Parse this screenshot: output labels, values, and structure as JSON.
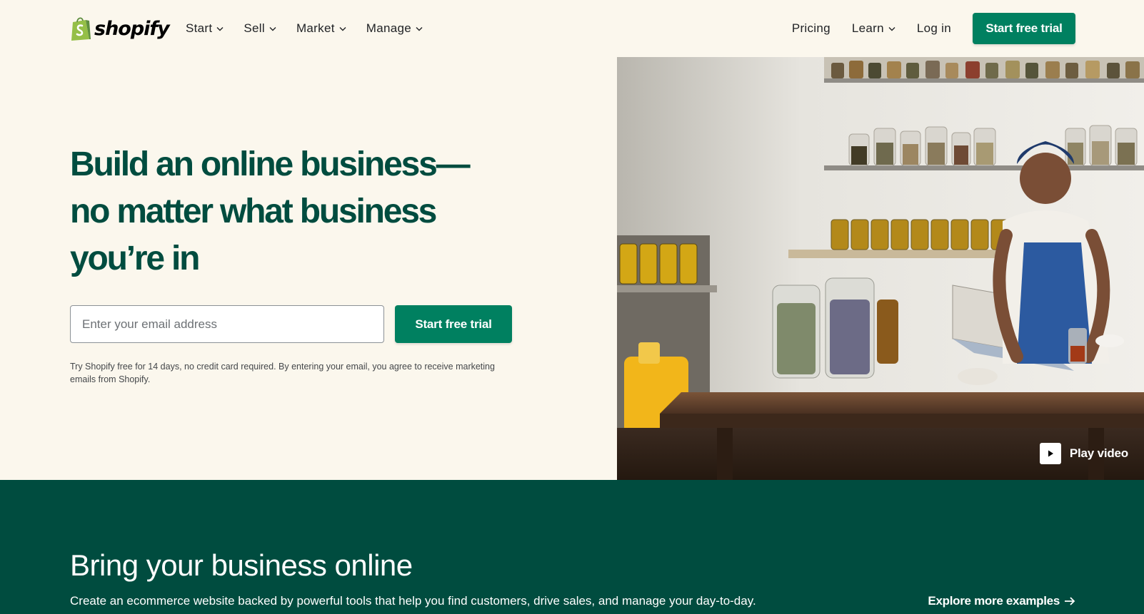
{
  "nav": {
    "logo_text": "shopify",
    "left_items": [
      {
        "label": "Start"
      },
      {
        "label": "Sell"
      },
      {
        "label": "Market"
      },
      {
        "label": "Manage"
      }
    ],
    "pricing": "Pricing",
    "learn": "Learn",
    "login": "Log in",
    "cta": "Start free trial"
  },
  "hero": {
    "title_line1": "Build an online business—",
    "title_line2": "no matter what business",
    "title_line3": "you’re in",
    "email_placeholder": "Enter your email address",
    "cta": "Start free trial",
    "disclaimer": "Try Shopify free for 14 days, no credit card required. By entering your email, you agree to receive marketing emails from Shopify.",
    "play_video": "Play video"
  },
  "section": {
    "title": "Bring your business online",
    "subtitle": "Create an ecommerce website backed by powerful tools that help you find customers, drive sales, and manage your day-to-day.",
    "explore": "Explore more examples"
  },
  "colors": {
    "page_bg": "#fbf7ed",
    "brand_green": "#008060",
    "dark_green": "#004c3f",
    "logo_green": "#95bf47"
  }
}
